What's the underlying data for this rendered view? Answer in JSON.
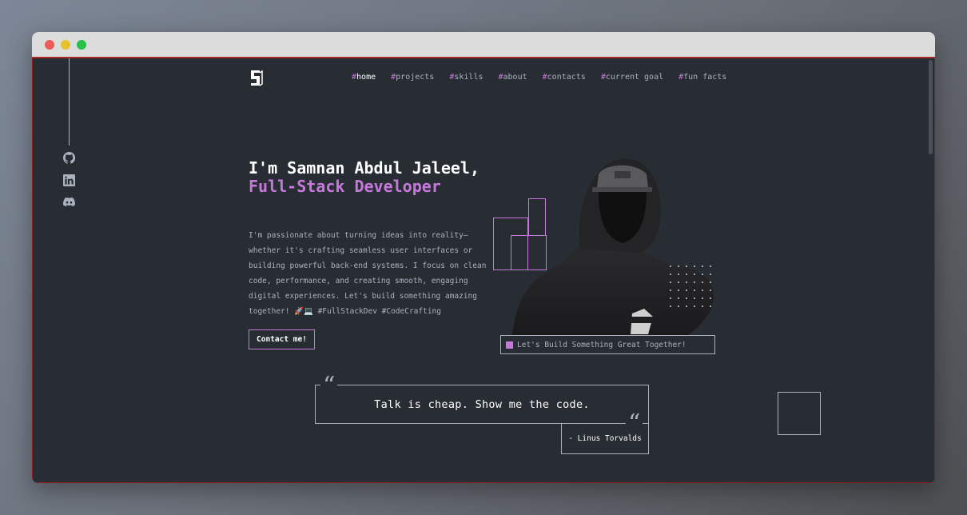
{
  "nav": {
    "items": [
      {
        "hash": "#",
        "label": "home",
        "active": true
      },
      {
        "hash": "#",
        "label": "projects"
      },
      {
        "hash": "#",
        "label": "skills"
      },
      {
        "hash": "#",
        "label": "about"
      },
      {
        "hash": "#",
        "label": "contacts"
      },
      {
        "hash": "#",
        "label": "current goal"
      },
      {
        "hash": "#",
        "label": "fun facts"
      }
    ]
  },
  "social": [
    "github-icon",
    "linkedin-icon",
    "discord-icon"
  ],
  "hero": {
    "title_plain": "I'm Samnan Abdul Jaleel, ",
    "title_accent": "Full-Stack Developer",
    "description": "I'm passionate about turning ideas into reality—whether it's crafting seamless user interfaces or building powerful back-end systems. I focus on clean code, performance, and creating smooth, engaging digital experiences. Let's build something amazing together! 🚀💻 #FullStackDev #CodeCrafting",
    "contact_button": "Contact me!",
    "caption": "Let's Build Something Great Together!"
  },
  "quote": {
    "text": "Talk is cheap. Show me the code.",
    "author": "- Linus Torvalds"
  },
  "colors": {
    "accent": "#c778dd",
    "background": "#282c33",
    "text_muted": "#abb2bf",
    "text": "#ffffff"
  }
}
